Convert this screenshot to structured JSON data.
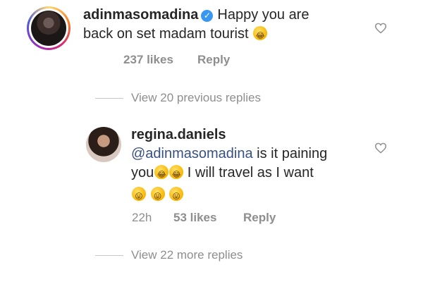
{
  "comment1": {
    "username": "adinmasomadina",
    "text": "Happy you are",
    "text_line2": "back on set madam tourist",
    "likes": "237 likes",
    "reply": "Reply"
  },
  "view_previous": "View 20 previous replies",
  "comment2": {
    "username": "regina.daniels",
    "mention": "@adinmasomadina",
    "text_line1": " is it paining",
    "text_line2_start": "you",
    "text_line2_end": " I will travel as I want",
    "time": "22h",
    "likes": "53 likes",
    "reply": "Reply"
  },
  "view_more": "View 22 more replies",
  "colors": {
    "link": "#385185",
    "muted": "#8e8e8e",
    "verified": "#3897f0"
  }
}
